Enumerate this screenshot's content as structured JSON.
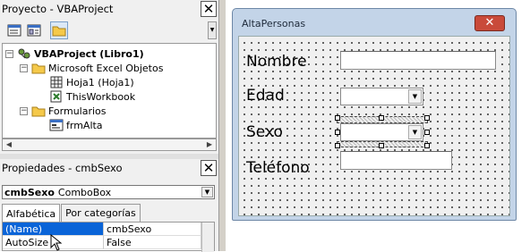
{
  "project_panel": {
    "title": "Proyecto - VBAProject",
    "close_glyph": "✕",
    "toolbar": [
      {
        "name": "view-code-button",
        "icon": "view-code-icon"
      },
      {
        "name": "view-object-button",
        "icon": "view-object-icon"
      },
      {
        "name": "toggle-folders-button",
        "icon": "folder-icon",
        "selected": true
      }
    ],
    "tree": [
      {
        "label": "VBAProject (Libro1)",
        "bold": true,
        "expander": "−",
        "icon": "vba-project-icon"
      },
      {
        "label": "Microsoft Excel Objetos",
        "expander": "−",
        "icon": "folder-open-icon"
      },
      {
        "label": "Hoja1 (Hoja1)",
        "icon": "worksheet-icon"
      },
      {
        "label": "ThisWorkbook",
        "icon": "workbook-icon"
      },
      {
        "label": "Formularios",
        "expander": "−",
        "icon": "folder-open-icon"
      },
      {
        "label": "frmAlta",
        "icon": "userform-icon"
      }
    ]
  },
  "properties_panel": {
    "title": "Propiedades - cmbSexo",
    "close_glyph": "✕",
    "object_name": "cmbSexo",
    "object_type": "ComboBox",
    "tabs": [
      "Alfabética",
      "Por categorías"
    ],
    "rows": [
      {
        "name": "(Name)",
        "value": "cmbSexo",
        "selected": true
      },
      {
        "name": "AutoSize",
        "value": "False"
      }
    ]
  },
  "form": {
    "caption": "AltaPersonas",
    "close_glyph": "✕",
    "labels": {
      "nombre": "Nombre",
      "edad": "Edad",
      "sexo": "Sexo",
      "telefono": "Teléfono"
    }
  },
  "colors": {
    "selection": "#0a64d8",
    "form_border": "#6d87a6",
    "form_close": "#c94a3a"
  }
}
